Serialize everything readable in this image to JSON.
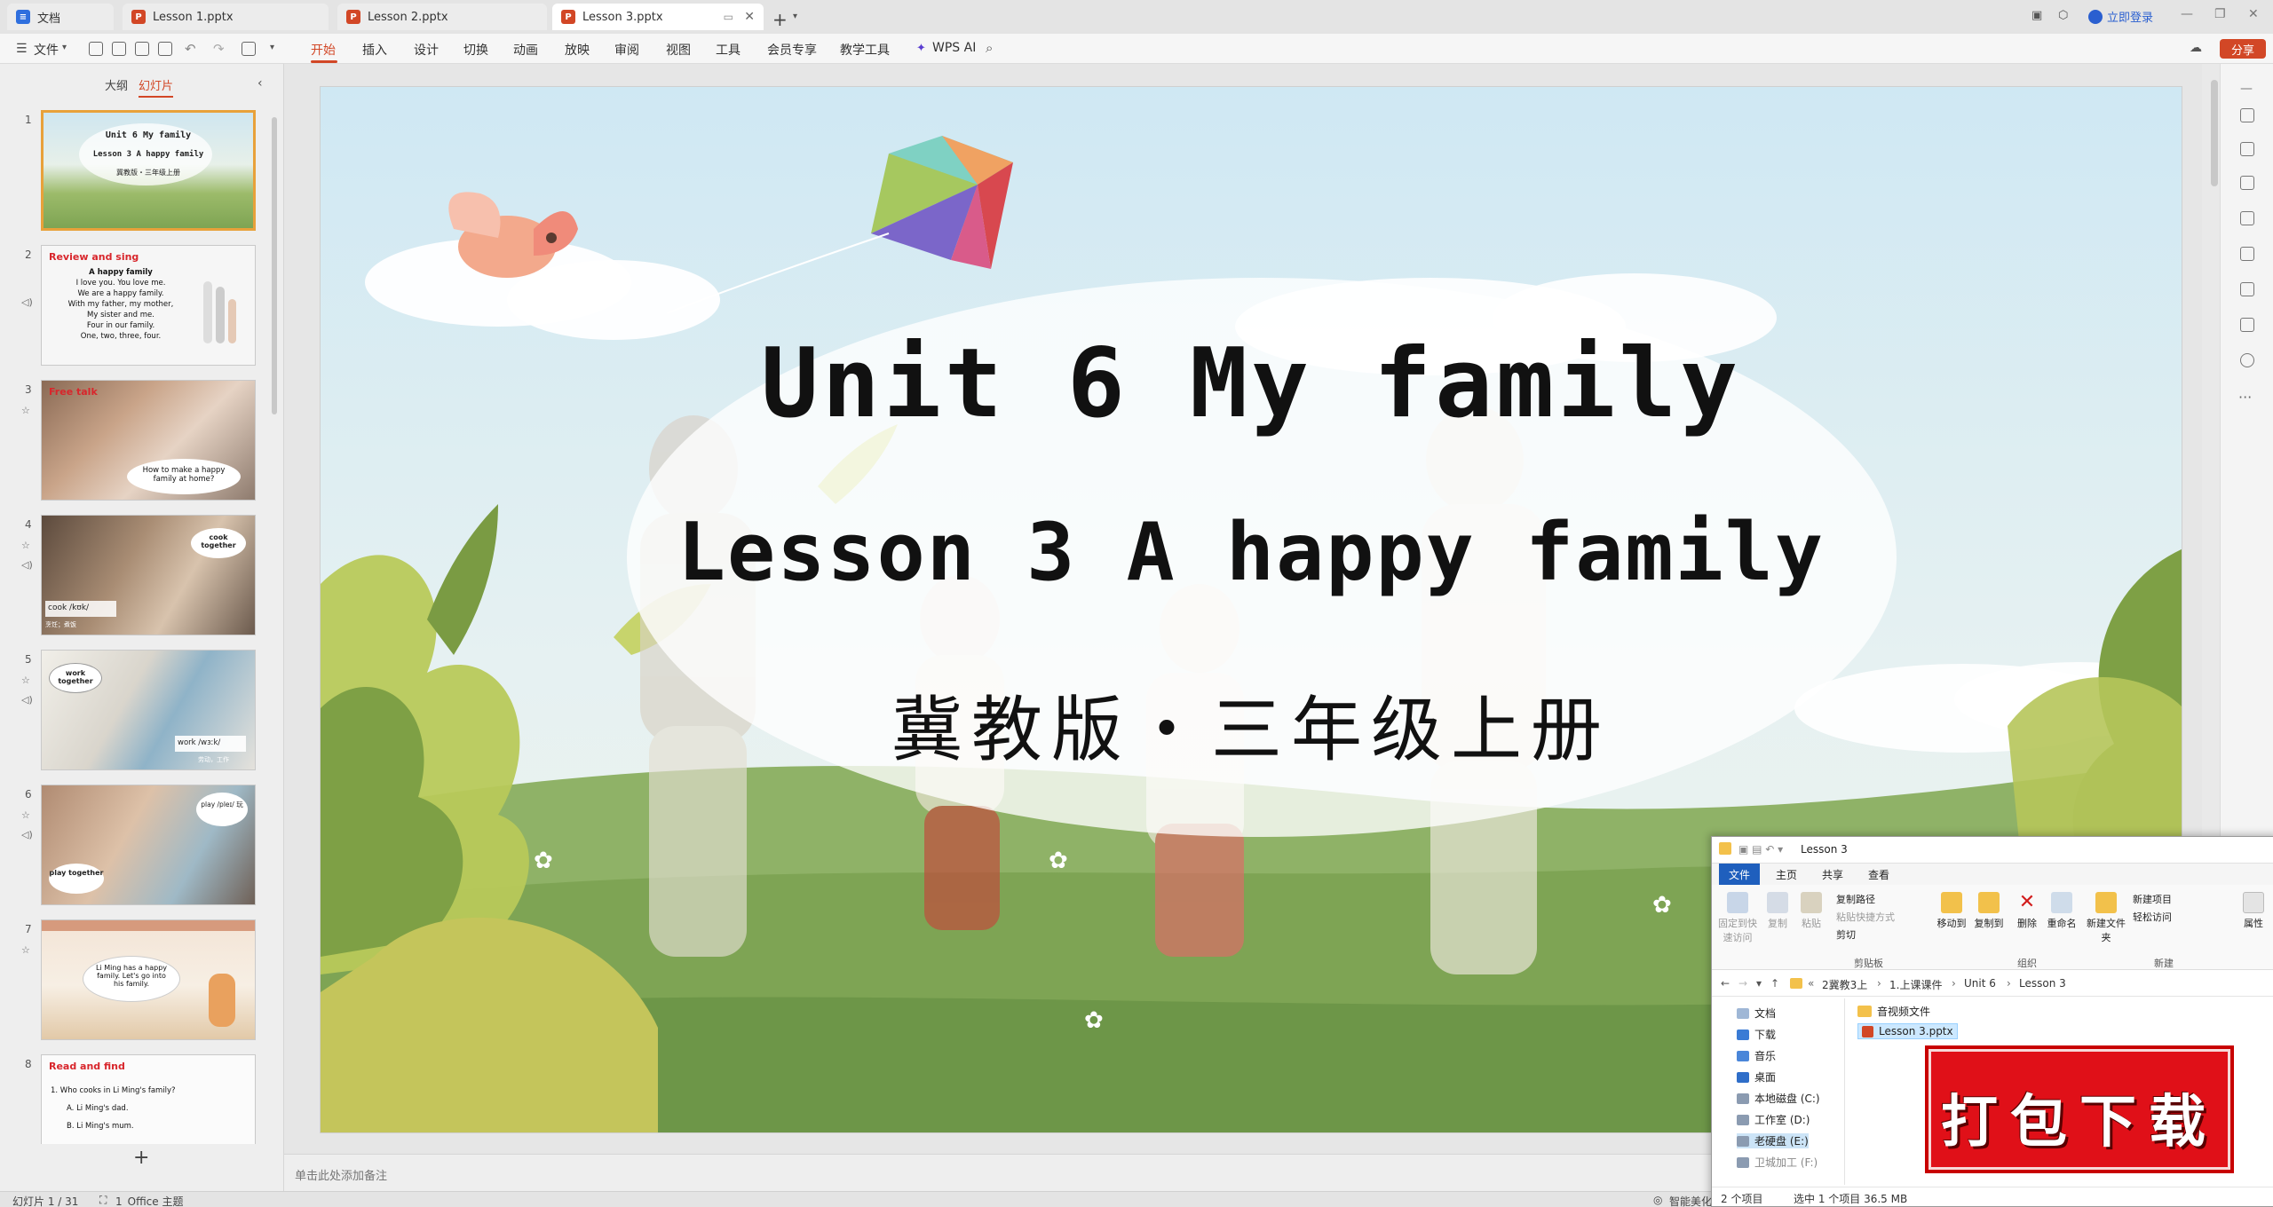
{
  "tabs": [
    {
      "label": "文档",
      "type": "doc",
      "active": false
    },
    {
      "label": "Lesson 1.pptx",
      "type": "ppt",
      "active": false
    },
    {
      "label": "Lesson 2.pptx",
      "type": "ppt",
      "active": false
    },
    {
      "label": "Lesson 3.pptx",
      "type": "ppt",
      "active": true
    }
  ],
  "titlebar": {
    "login_label": "立即登录"
  },
  "menu": {
    "file": "文件",
    "items": [
      "开始",
      "插入",
      "设计",
      "切换",
      "动画",
      "放映",
      "审阅",
      "视图",
      "工具",
      "会员专享",
      "教学工具"
    ],
    "active": "开始",
    "wps_ai": "WPS AI",
    "share": "分享"
  },
  "leftpanel": {
    "tab_outline": "大纲",
    "tab_slides": "幻灯片",
    "thumbs": [
      {
        "num": "1",
        "title": "",
        "lines": [
          "Unit 6 My family",
          "Lesson 3 A happy family",
          "冀教版・三年级上册"
        ]
      },
      {
        "num": "2",
        "title": "Review and sing",
        "lines": [
          "A happy family",
          "I love you. You love me.",
          "We are a happy family.",
          "With my father, my mother,",
          "My sister and me.",
          "Four in our family.",
          "One, two, three, four."
        ]
      },
      {
        "num": "3",
        "title": "Free talk",
        "lines": [
          "How to make a happy",
          "family at home?"
        ]
      },
      {
        "num": "4",
        "title": "",
        "lines": [
          "cook together",
          "cook /kʊk/",
          "烹饪；煮饭"
        ]
      },
      {
        "num": "5",
        "title": "",
        "lines": [
          "work together",
          "work /wɜːk/",
          "劳动，工作"
        ]
      },
      {
        "num": "6",
        "title": "",
        "lines": [
          "play /pleɪ/ 玩",
          "play together"
        ]
      },
      {
        "num": "7",
        "title": "",
        "lines": [
          "Li Ming has a happy",
          "family. Let's go into",
          "his family."
        ]
      },
      {
        "num": "8",
        "title": "Read and find",
        "lines": [
          "1. Who cooks in Li Ming's family?",
          "A. Li Ming's dad.",
          "B. Li Ming's mum."
        ]
      }
    ]
  },
  "slide": {
    "title": "Unit 6 My family",
    "subtitle": "Lesson 3 A happy family",
    "publisher": "冀教版・三年级上册"
  },
  "notes_placeholder": "单击此处添加备注",
  "statusbar": {
    "slide_indicator": "幻灯片 1 / 31",
    "theme": "1_Office 主题",
    "smart": "智能美化"
  },
  "explorer": {
    "title": "Lesson 3",
    "tabs": [
      "文件",
      "主页",
      "共享",
      "查看"
    ],
    "ribbon": {
      "pin": "固定到快速访问",
      "copy": "复制",
      "paste": "粘贴",
      "copy_path": "复制路径",
      "paste_shortcut": "粘贴快捷方式",
      "cut": "剪切",
      "move_to": "移动到",
      "copy_to": "复制到",
      "delete": "删除",
      "rename": "重命名",
      "new_folder": "新建文件夹",
      "new_item": "新建项目",
      "easy_access": "轻松访问",
      "properties": "属性",
      "group_clipboard": "剪贴板",
      "group_organize": "组织",
      "group_new": "新建"
    },
    "breadcrumb": [
      "2冀教3上",
      "1.上课课件",
      "Unit 6",
      "Lesson 3"
    ],
    "nav": [
      "文档",
      "下载",
      "音乐",
      "桌面",
      "本地磁盘 (C:)",
      "工作室 (D:)",
      "老硬盘 (E:)",
      "卫城加工 (F:)"
    ],
    "files": [
      "音视频文件",
      "Lesson 3.pptx"
    ],
    "status_count": "2 个项目",
    "status_selected": "选中 1 个项目 36.5 MB"
  },
  "stamp": {
    "text": "打包下载"
  }
}
